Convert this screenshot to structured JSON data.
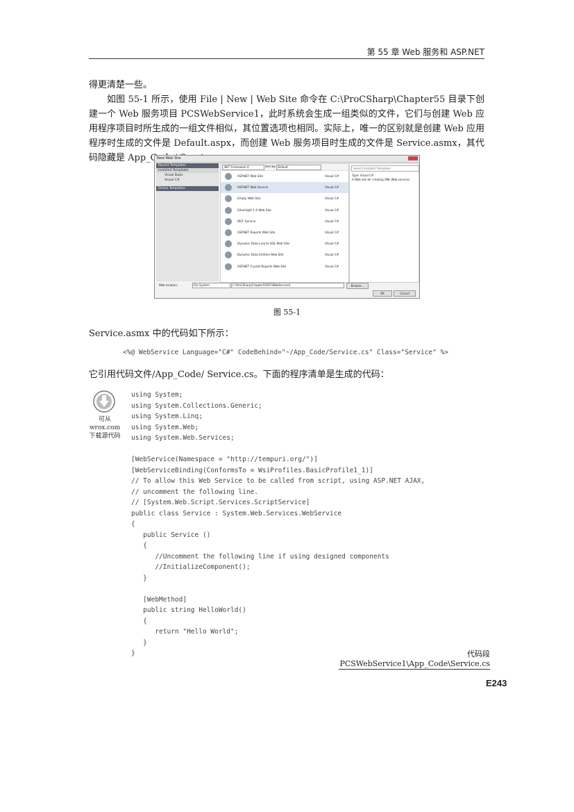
{
  "header": {
    "chapter_title": "第 55 章   Web 服务和 ASP.NET"
  },
  "paragraphs": {
    "p1": "得更清楚一些。",
    "p2": "如图 55-1 所示，使用 File | New | Web Site 命令在 C:\\ProCSharp\\Chapter55 目录下创建一个 Web 服务项目 PCSWebService1，此时系统会生成一组类似的文件，它们与创建 Web 应用程序项目时所生成的一组文件相似，其位置选项也相同。实际上，唯一的区别就是创建 Web 应用程序时生成的文件是 Default.aspx，而创建 Web 服务项目时生成的文件是 Service.asmx，其代码隐藏是 App_Code/ Service.cs。",
    "p3": "Service.asmx 中的代码如下所示：",
    "p4": "它引用代码文件/App_Code/ Service.cs。下面的程序清单是生成的代码："
  },
  "figure": {
    "window_title": "New Web Site",
    "left_panel": {
      "recent": "Recent Templates",
      "installed": "Installed Templates",
      "items": [
        "Visual Basic",
        "Visual C#"
      ],
      "online": "Online Templates"
    },
    "toolbar": {
      "framework": ".NET Framework 4",
      "sortby_label": "Sort by:",
      "sortby_value": "Default"
    },
    "templates": [
      {
        "name": "ASP.NET Web Site",
        "lang": "Visual C#"
      },
      {
        "name": "ASP.NET Web Service",
        "lang": "Visual C#"
      },
      {
        "name": "Empty Web Site",
        "lang": "Visual C#"
      },
      {
        "name": "Silverlight 1.0 Web Site",
        "lang": "Visual C#"
      },
      {
        "name": "WCF Service",
        "lang": "Visual C#"
      },
      {
        "name": "ASP.NET Reports Web Site",
        "lang": "Visual C#"
      },
      {
        "name": "Dynamic Data Linq to SQL Web Site",
        "lang": "Visual C#"
      },
      {
        "name": "Dynamic Data Entities Web Site",
        "lang": "Visual C#"
      },
      {
        "name": "ASP.NET Crystal Reports Web Site",
        "lang": "Visual C#"
      }
    ],
    "right_panel": {
      "search_placeholder": "Search Installed Templates",
      "type": "Type: Visual C#",
      "description": "A Web site for creating XML Web services"
    },
    "bottom": {
      "location_label": "Web location:",
      "location_value": "File System",
      "path": "C:\\ProCSharp\\Chapter55\\PCSWebService1",
      "browse": "Browse...",
      "ok": "OK",
      "cancel": "Cancel"
    }
  },
  "caption": "图   55-1",
  "code_line": "<%@ WebService Language=\"C#\" CodeBehind=\"~/App_Code/Service.cs\" Class=\"Service\" %>",
  "download": {
    "line1": "可从",
    "line2": "wrox.com",
    "line3": "下载源代码"
  },
  "code": [
    "using System;",
    "using System.Collections.Generic;",
    "using System.Linq;",
    "using System.Web;",
    "using System.Web.Services;",
    "",
    "[WebService(Namespace = \"http://tempuri.org/\")]",
    "[WebServiceBinding(ConformsTo = WsiProfiles.BasicProfile1_1)]",
    "// To allow this Web Service to be called from script, using ASP.NET AJAX,",
    "// uncomment the following line.",
    "// [System.Web.Script.Services.ScriptService]",
    "public class Service : System.Web.Services.WebService",
    "{",
    "   public Service ()",
    "   {",
    "      //Uncomment the following line if using designed components",
    "      //InitializeComponent();",
    "   }",
    "",
    "   [WebMethod]",
    "   public string HelloWorld()",
    "   {",
    "      return \"Hello World\";",
    "   }",
    "}"
  ],
  "code_footnote": "代码段 PCSWebService1\\App_Code\\Service.cs",
  "page_number": "E243"
}
